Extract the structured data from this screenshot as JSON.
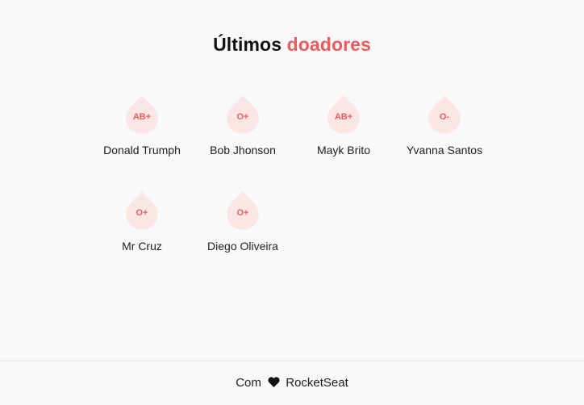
{
  "header": {
    "title_prefix": "Últimos",
    "title_accent": "doadores"
  },
  "colors": {
    "accent": "#ec5b5b",
    "drop_fill": "#fbe6e6",
    "background": "#f9f9f9"
  },
  "donors": [
    {
      "name": "Donald Trumph",
      "blood": "AB+"
    },
    {
      "name": "Bob Jhonson",
      "blood": "O+"
    },
    {
      "name": "Mayk Brito",
      "blood": "AB+"
    },
    {
      "name": "Yvanna Santos",
      "blood": "O-"
    },
    {
      "name": "Mr Cruz",
      "blood": "O+"
    },
    {
      "name": "Diego Oliveira",
      "blood": "O+"
    }
  ],
  "footer": {
    "prefix": "Com",
    "icon": "heart-icon",
    "brand": "RocketSeat"
  }
}
